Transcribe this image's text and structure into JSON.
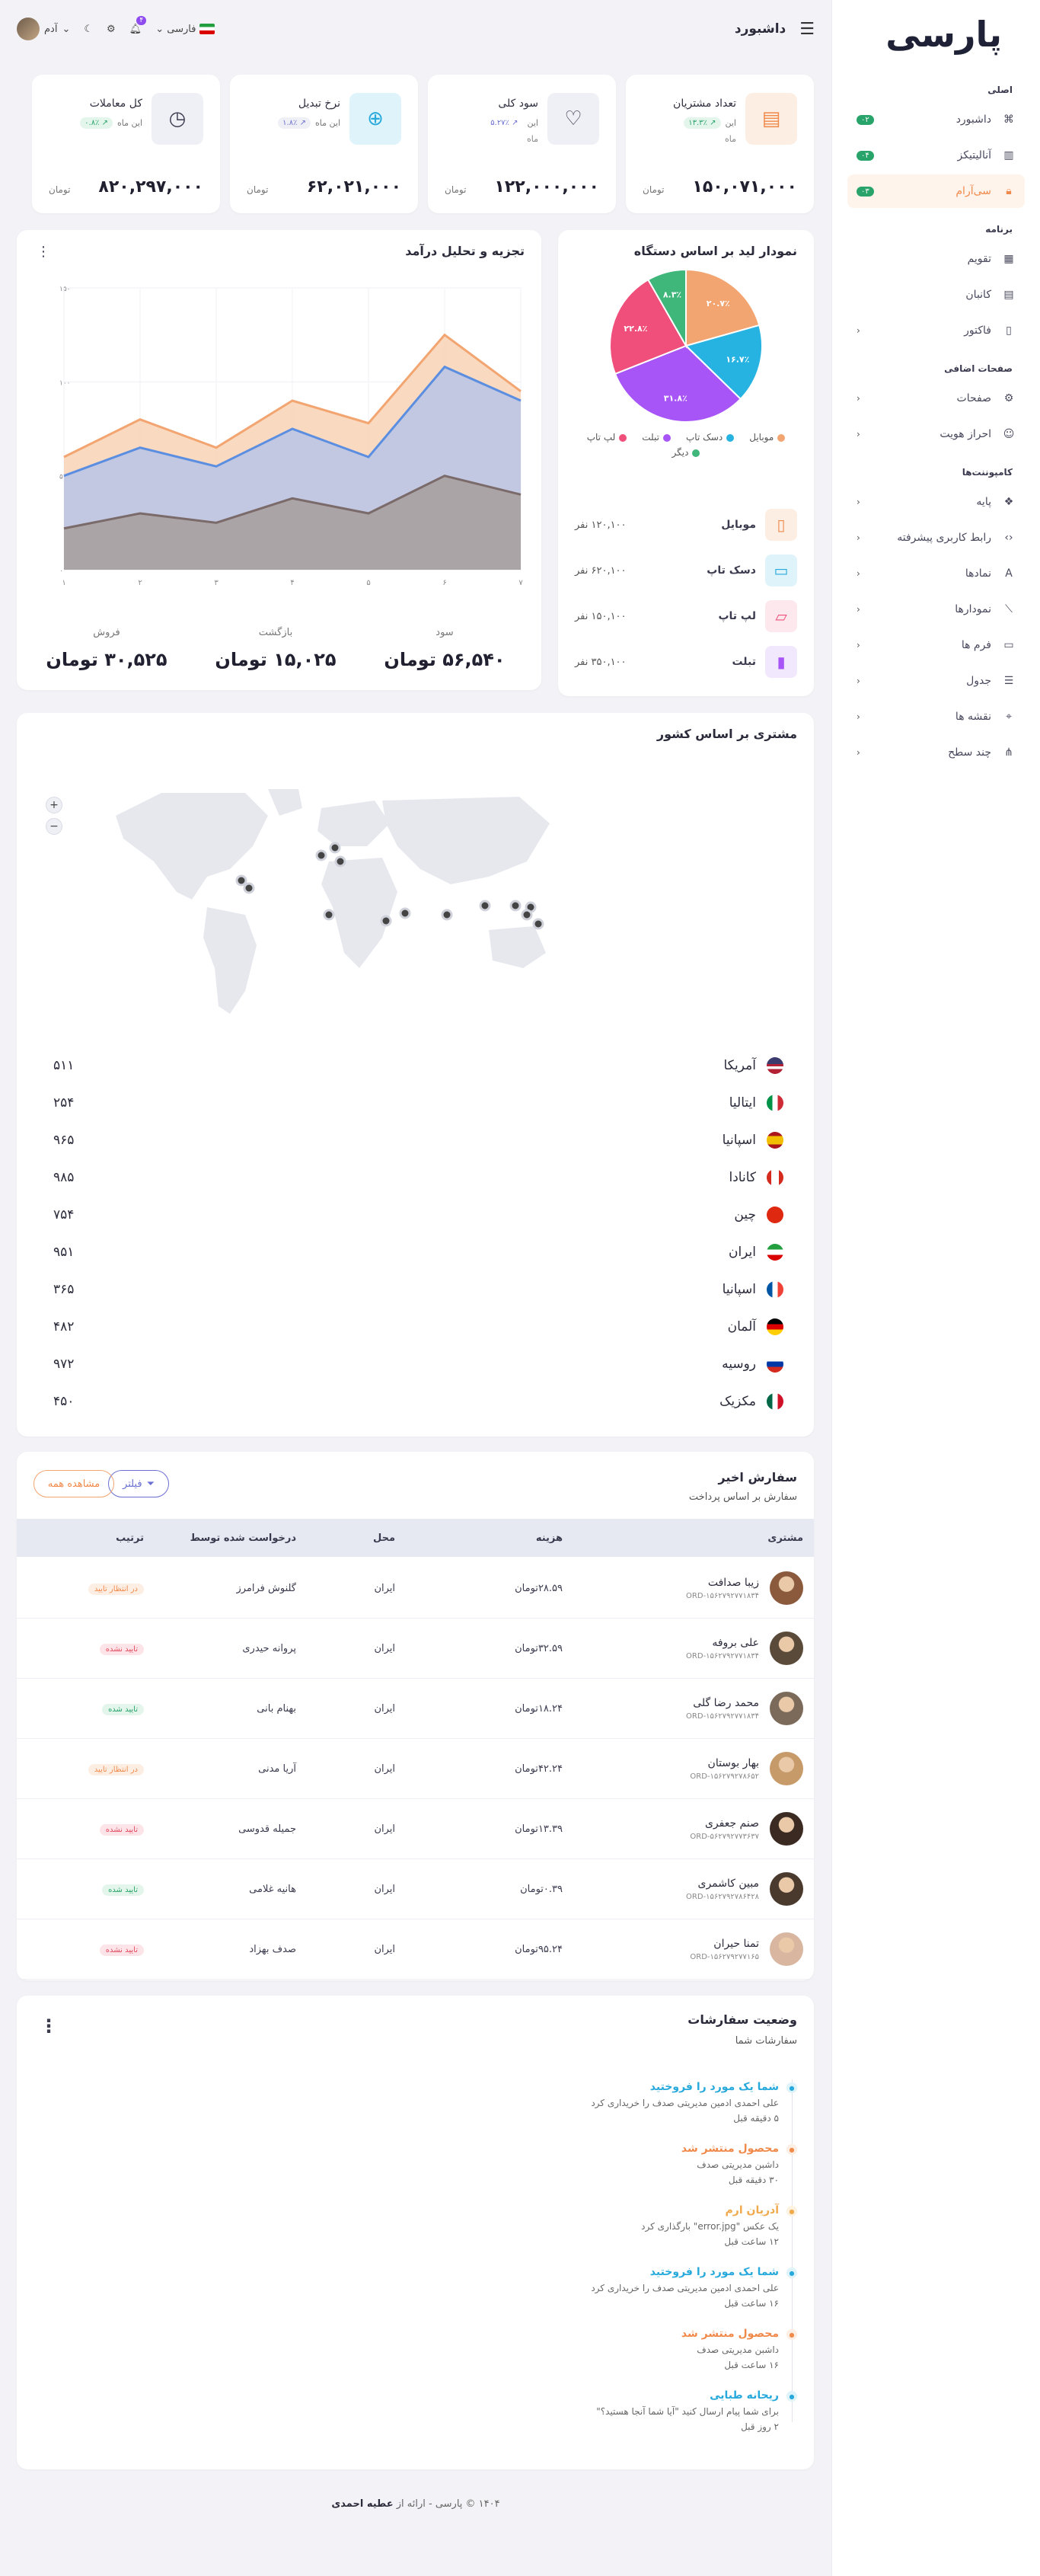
{
  "sidebar": {
    "logo_main": "پارسی",
    "sections": {
      "main": "اصلی",
      "app": "برنامه",
      "extra": "صفحات اضافی",
      "components": "کامپوننت‌ها"
    },
    "items": [
      {
        "label": "داشبورد",
        "badge": "۰۲",
        "icon": "command-icon"
      },
      {
        "label": "آنالیتیکز",
        "badge": "۰۴",
        "icon": "chart-icon"
      },
      {
        "label": "سی‌آر‌ام",
        "badge": "۰۳",
        "icon": "lock-icon"
      },
      {
        "label": "تقویم",
        "icon": "calendar-icon"
      },
      {
        "label": "کانبان",
        "icon": "kanban-icon"
      },
      {
        "label": "فاکتور",
        "icon": "file-icon"
      },
      {
        "label": "صفحات",
        "icon": "gear-icon"
      },
      {
        "label": "احراز هویت",
        "icon": "user-icon"
      },
      {
        "label": "پایه",
        "icon": "component-icon"
      },
      {
        "label": "رابط کاربری پیشرفته",
        "icon": "code-icon"
      },
      {
        "label": "نمادها",
        "icon": "type-icon"
      },
      {
        "label": "نمودارها",
        "icon": "line-chart-icon"
      },
      {
        "label": "فرم ها",
        "icon": "clipboard-icon"
      },
      {
        "label": "جدول",
        "icon": "table-icon"
      },
      {
        "label": "نقشه ها",
        "icon": "pin-icon"
      },
      {
        "label": "چند سطح",
        "icon": "share-icon"
      }
    ]
  },
  "topbar": {
    "title": "داشبورد",
    "language": "فارسی",
    "notif_count": "۴",
    "user": "آدم"
  },
  "stats": [
    {
      "title": "تعداد مشتریان",
      "change": "۱۳.۳٪",
      "change_label": "این",
      "period": "ماه",
      "value": "۱۵۰,۰۷۱,۰۰۰",
      "unit": "تومان",
      "icon": "customers-icon",
      "icon_bg": "#fdeee4",
      "icon_color": "#f08a4b",
      "pill_bg": "#e4f6ec",
      "pill_color": "#28a36a"
    },
    {
      "title": "سود کلی",
      "change": "۵.۲۷٪",
      "change_label": "این",
      "period": "ماه",
      "value": "۱۲۲,۰۰۰,۰۰۰",
      "unit": "تومان",
      "icon": "heart-file-icon",
      "icon_bg": "#eef0f5",
      "icon_color": "#3b3b4f",
      "pill_bg": "#ffffff",
      "pill_color": "#6b6fd1"
    },
    {
      "title": "نرخ تبدیل",
      "change": "۱.۸٪",
      "change_label": "این ماه",
      "period": "",
      "value": "۶۲,۰۲۱,۰۰۰",
      "unit": "تومان",
      "icon": "add-file-icon",
      "icon_bg": "#dff3fb",
      "icon_color": "#27a9db",
      "pill_bg": "#eef0f5",
      "pill_color": "#6b6fd1"
    },
    {
      "title": "کل معاملات",
      "change": "۰.۸٪",
      "change_label": "این ماه",
      "period": "",
      "value": "۸۲۰,۲۹۷,۰۰۰",
      "unit": "تومان",
      "icon": "clock-file-icon",
      "icon_bg": "#eef0f5",
      "icon_color": "#3b3b4f",
      "pill_bg": "#e4f6ec",
      "pill_color": "#28a36a"
    }
  ],
  "device": {
    "title": "نمودار لید بر اساس دستگاه",
    "legend": [
      "موبایل",
      "دسک تاپ",
      "تبلت",
      "لپ تاپ",
      "دیگر"
    ],
    "rows": [
      {
        "name": "موبایل",
        "value": "۱۲۰,۱۰۰ نفر",
        "icon": "mobile-icon",
        "bg": "#fdeee4",
        "color": "#f08a4b"
      },
      {
        "name": "دسک تاپ",
        "value": "۶۲۰,۱۰۰ نفر",
        "icon": "desktop-icon",
        "bg": "#dff3fb",
        "color": "#27a9db"
      },
      {
        "name": "لپ تاپ",
        "value": "۱۵۰,۱۰۰ نفر",
        "icon": "laptop-icon",
        "bg": "#fde8ee",
        "color": "#ef4f7a"
      },
      {
        "name": "تبلت",
        "value": "۳۵۰,۱۰۰ نفر",
        "icon": "tablet-icon",
        "bg": "#f1e8fd",
        "color": "#a855f7"
      }
    ]
  },
  "revenue": {
    "title": "تجزیه و تحلیل درآمد",
    "summary": [
      {
        "label": "سود",
        "value": "۵۶,۵۴۰ تومان"
      },
      {
        "label": "بازگشت",
        "value": "۱۵,۰۲۵ تومان"
      },
      {
        "label": "فروش",
        "value": "۳۰,۵۲۵ تومان"
      }
    ]
  },
  "chart_data": [
    {
      "type": "pie",
      "title": "نمودار لید بر اساس دستگاه",
      "categories": [
        "موبایل",
        "دسک تاپ",
        "تبلت",
        "لپ تاپ",
        "دیگر"
      ],
      "values": [
        20.7,
        16.7,
        31.8,
        22.8,
        8.3
      ],
      "labels": [
        "۲۰.۷٪",
        "۱۶.۷٪",
        "۳۱.۸٪",
        "۲۲.۸٪",
        "۸.۳٪"
      ],
      "colors": [
        "#f3a571",
        "#27b3e2",
        "#a855f7",
        "#ef4f7a",
        "#3fb67a"
      ]
    },
    {
      "type": "area",
      "title": "تجزیه و تحلیل درآمد",
      "x": [
        "۱",
        "۲",
        "۳",
        "۴",
        "۵",
        "۶",
        "۷"
      ],
      "y_ticks": [
        "۰",
        "۵۰",
        "۱۰۰",
        "۱۵۰"
      ],
      "ylim": [
        0,
        150
      ],
      "series": [
        {
          "values": [
            60,
            80,
            65,
            90,
            78,
            125,
            95
          ],
          "color": "#f3a571"
        },
        {
          "values": [
            50,
            65,
            55,
            75,
            60,
            108,
            90
          ],
          "color": "#5b8ee0"
        },
        {
          "values": [
            22,
            30,
            25,
            38,
            30,
            50,
            40
          ],
          "color": "#7a6a6a"
        }
      ]
    }
  ],
  "country": {
    "title": "مشتری بر اساس کشور",
    "zoom_in": "+",
    "zoom_out": "−",
    "rows": [
      {
        "name": "آمریکا",
        "value": "۵۱۱",
        "flag": "us"
      },
      {
        "name": "ایتالیا",
        "value": "۲۵۴",
        "flag": "it"
      },
      {
        "name": "اسپانیا",
        "value": "۹۶۵",
        "flag": "es"
      },
      {
        "name": "کانادا",
        "value": "۹۸۵",
        "flag": "ca"
      },
      {
        "name": "چین",
        "value": "۷۵۴",
        "flag": "cn"
      },
      {
        "name": "ایران",
        "value": "۹۵۱",
        "flag": "ir"
      },
      {
        "name": "اسپانیا",
        "value": "۳۶۵",
        "flag": "fr"
      },
      {
        "name": "آلمان",
        "value": "۴۸۲",
        "flag": "de"
      },
      {
        "name": "روسیه",
        "value": "۹۷۲",
        "flag": "ru"
      },
      {
        "name": "مکزیک",
        "value": "۴۵۰",
        "flag": "mx"
      }
    ]
  },
  "orders": {
    "title": "سفارش اخیر",
    "subtitle": "سفارش بر اساس پرداخت",
    "filter_label": "فیلتر",
    "view_all": "مشاهده همه",
    "columns": [
      "مشتری",
      "هزینه",
      "محل",
      "درخواست شده توسط",
      "ترتیب"
    ],
    "rows": [
      {
        "name": "زیبا صدافت",
        "code": "ORD-۱۵۶۲۷۹۲۷۷۱۸۳۴",
        "cost": "۲۸.۵۹تومان",
        "place": "ایران",
        "by": "گلنوش فرامرز",
        "status": "در انتظار تایید",
        "status_bg": "#fdeee4",
        "status_color": "#f08a4b"
      },
      {
        "name": "علی بروفه",
        "code": "ORD-۱۵۶۲۷۹۲۷۷۱۸۳۴",
        "cost": "۳۲.۵۹تومان",
        "place": "ایران",
        "by": "پروانه حیدری",
        "status": "تایید نشده",
        "status_bg": "#fde4e8",
        "status_color": "#e04a5f"
      },
      {
        "name": "محمد رضا گلی",
        "code": "ORD-۱۵۶۲۷۹۲۷۷۱۸۳۴",
        "cost": "۱۸.۲۴تومان",
        "place": "ایران",
        "by": "بهنام بانی",
        "status": "تایید شده",
        "status_bg": "#e4f6ec",
        "status_color": "#28a36a"
      },
      {
        "name": "بهار بوستان",
        "code": "ORD-۱۵۶۲۷۹۲۷۸۶۵۲",
        "cost": "۴۲.۲۴تومان",
        "place": "ایران",
        "by": "آریا مدنی",
        "status": "در انتظار تایید",
        "status_bg": "#fdeee4",
        "status_color": "#f08a4b"
      },
      {
        "name": "صنم جعفری",
        "code": "ORD-۵۶۲۷۹۲۷۷۳۶۳۷",
        "cost": "۱۳.۳۹تومان",
        "place": "ایران",
        "by": "جمیله قدوسی",
        "status": "تایید نشده",
        "status_bg": "#fde4e8",
        "status_color": "#e04a5f"
      },
      {
        "name": "مبین کاشمری",
        "code": "ORD-۱۵۶۲۷۹۲۷۸۶۴۲۸",
        "cost": "۰.۳۹تومان",
        "place": "ایران",
        "by": "هانیه غلامی",
        "status": "تایید شده",
        "status_bg": "#e4f6ec",
        "status_color": "#28a36a"
      },
      {
        "name": "تمنا حیران",
        "code": "ORD-۱۵۶۲۷۹۲۷۷۱۶۵",
        "cost": "۹۵.۲۴تومان",
        "place": "ایران",
        "by": "صدف بهزاد",
        "status": "تایید نشده",
        "status_bg": "#fde4e8",
        "status_color": "#e04a5f"
      }
    ]
  },
  "order_status": {
    "title": "وضعیت سفارشات",
    "subtitle": "سفارشات شما",
    "items": [
      {
        "title": "شما یک مورد را فروختید",
        "desc": "علی احمدی ادمین مدیریتی صدف را خریداری کرد",
        "time": "۵ دقیقه قبل",
        "color": "#27a9db",
        "bg": "#dff3fb"
      },
      {
        "title": "محصول منتشر شد",
        "desc": "داشبن مدیریتی صدف",
        "time": "۳۰ دقیقه قبل",
        "color": "#f08a4b",
        "bg": "#fdeee4"
      },
      {
        "title": "آدریان ارم",
        "desc": "یک عکس \"error.jpg\" بارگذاری کرد",
        "time": "۱۲ ساعت قبل",
        "color": "#f0a94b",
        "bg": "#fdf2e0"
      },
      {
        "title": "شما یک مورد را فروختید",
        "desc": "علی احمدی ادمین مدیریتی صدف را خریداری کرد",
        "time": "۱۶ ساعت قبل",
        "color": "#27a9db",
        "bg": "#dff3fb"
      },
      {
        "title": "محصول منتشر شد",
        "desc": "داشبن مدیریتی صدف",
        "time": "۱۶ ساعت قبل",
        "color": "#f08a4b",
        "bg": "#fdeee4"
      },
      {
        "title": "ریحانه طبایی",
        "desc": "برای شما پیام ارسال کنید \"آیا شما آنجا هستید؟\"",
        "time": "۲ روز قبل",
        "color": "#27a9db",
        "bg": "#dff3fb"
      }
    ]
  },
  "footer": {
    "text": "۱۴۰۴ © پارسی - ارائه از",
    "author": "عطیه احمدی"
  }
}
